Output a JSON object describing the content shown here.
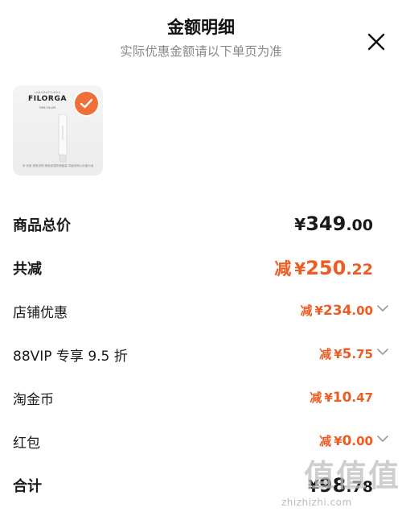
{
  "header": {
    "title": "金额明细",
    "subtitle": "实际优惠金额请以下单页为准"
  },
  "product": {
    "brand_top": "LABORATOIRES",
    "brand": "FILORGA",
    "tag": "TIME-FILLER",
    "fine_print": "本·优惠·参数说明 精致保湿防晒套装 详细说明以页面为准"
  },
  "summary": {
    "total_price_label": "商品总价",
    "total_price_currency": "¥",
    "total_price_int": "349",
    "total_price_dec": ".00",
    "total_discount_label": "共减",
    "total_discount_prefix": "减",
    "total_discount_currency": "¥",
    "total_discount_int": "250",
    "total_discount_dec": ".22"
  },
  "discounts": [
    {
      "label": "店铺优惠",
      "prefix": "减",
      "currency": "¥",
      "int": "234",
      "dec": ".00",
      "expandable": true
    },
    {
      "label": "88VIP 专享 9.5 折",
      "prefix": "减",
      "currency": "¥",
      "int": "5",
      "dec": ".75",
      "expandable": true
    },
    {
      "label": "淘金币",
      "prefix": "减",
      "currency": "¥",
      "int": "10",
      "dec": ".47",
      "expandable": false
    },
    {
      "label": "红包",
      "prefix": "减",
      "currency": "¥",
      "int": "0",
      "dec": ".00",
      "expandable": true
    }
  ],
  "total": {
    "label": "合计",
    "currency": "¥",
    "int": "98",
    "dec": ".78"
  },
  "watermark": {
    "chars": "值值值",
    "site": "zhizhizhi.com"
  },
  "colors": {
    "accent": "#ef5b22",
    "badge": "#f06e3a",
    "text": "#1a1a1a",
    "muted": "#8a8a8a"
  },
  "icons": [
    "close-icon",
    "checkmark-icon",
    "chevron-down-icon"
  ]
}
